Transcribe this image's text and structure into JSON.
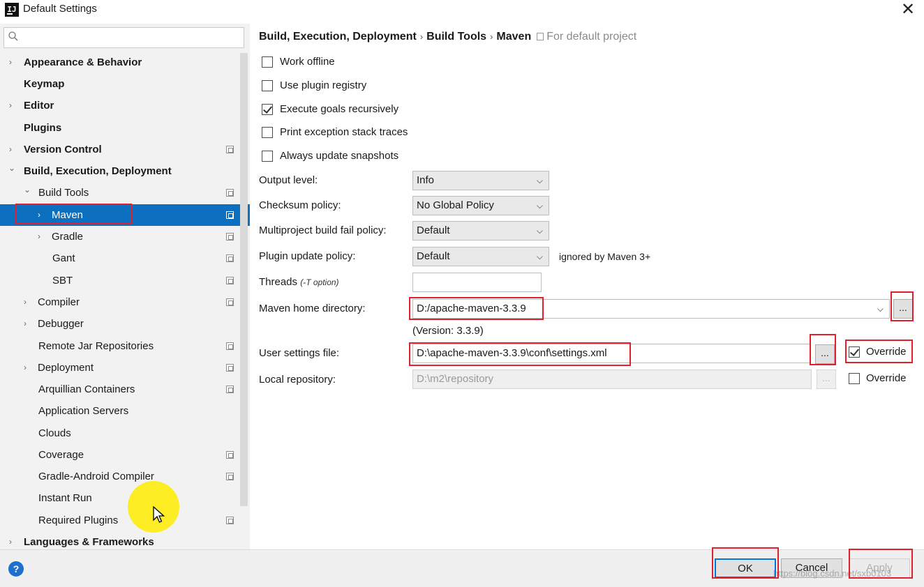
{
  "window": {
    "title": "Default Settings",
    "icon_text": "IJ",
    "close_glyph": "✕"
  },
  "search": {
    "placeholder": "",
    "value": ""
  },
  "sidebar": {
    "items": [
      {
        "label": "Appearance & Behavior",
        "expanded": false
      },
      {
        "label": "Keymap"
      },
      {
        "label": "Editor",
        "expanded": false
      },
      {
        "label": "Plugins"
      },
      {
        "label": "Version Control",
        "expanded": false
      },
      {
        "label": "Build, Execution, Deployment",
        "expanded": true
      },
      {
        "label": "Build Tools",
        "expanded": true
      },
      {
        "label": "Maven",
        "selected": true
      },
      {
        "label": "Gradle"
      },
      {
        "label": "Gant"
      },
      {
        "label": "SBT"
      },
      {
        "label": "Compiler"
      },
      {
        "label": "Debugger"
      },
      {
        "label": "Remote Jar Repositories"
      },
      {
        "label": "Deployment"
      },
      {
        "label": "Arquillian Containers"
      },
      {
        "label": "Application Servers"
      },
      {
        "label": "Clouds"
      },
      {
        "label": "Coverage"
      },
      {
        "label": "Gradle-Android Compiler"
      },
      {
        "label": "Instant Run"
      },
      {
        "label": "Required Plugins"
      },
      {
        "label": "Languages & Frameworks",
        "expanded": false
      }
    ],
    "arrow_collapsed": "›",
    "arrow_expanded": "⌄"
  },
  "breadcrumb": {
    "parts": [
      "Build, Execution, Deployment",
      "Build Tools",
      "Maven"
    ],
    "separator": "›",
    "scope_hint": "For default project"
  },
  "checkboxes": {
    "work_offline": {
      "label": "Work offline",
      "checked": false
    },
    "use_plugin_registry": {
      "label": "Use plugin registry",
      "checked": false
    },
    "execute_goals_recursively": {
      "label": "Execute goals recursively",
      "checked": true
    },
    "print_exception_stack_traces": {
      "label": "Print exception stack traces",
      "checked": false
    },
    "always_update_snapshots": {
      "label": "Always update snapshots",
      "checked": false
    }
  },
  "form": {
    "output_level": {
      "label": "Output level:",
      "value": "Info"
    },
    "checksum_policy": {
      "label": "Checksum policy:",
      "value": "No Global Policy"
    },
    "multiproject_fail_policy": {
      "label": "Multiproject build fail policy:",
      "value": "Default"
    },
    "plugin_update_policy": {
      "label": "Plugin update policy:",
      "value": "Default",
      "note": "ignored by Maven 3+"
    },
    "threads": {
      "label": "Threads",
      "hint": "(-T option)",
      "value": ""
    },
    "maven_home": {
      "label": "Maven home directory:",
      "value": "D:/apache-maven-3.3.9",
      "version": "(Version: 3.3.9)",
      "browse_label": "..."
    },
    "user_settings": {
      "label": "User settings file:",
      "value": "D:\\apache-maven-3.3.9\\conf\\settings.xml",
      "browse_label": "...",
      "override_label": "Override",
      "override_checked": true
    },
    "local_repo": {
      "label": "Local repository:",
      "value": "D:\\m2\\repository",
      "browse_label": "...",
      "override_label": "Override",
      "override_checked": false
    }
  },
  "buttons": {
    "ok": "OK",
    "cancel": "Cancel",
    "apply": "Apply",
    "help": "?"
  },
  "watermark": "https://blog.csdn.net/sxb0103",
  "colors": {
    "selection": "#0c6fc0",
    "highlight_box": "#e0202a",
    "primary_border": "#0078d7",
    "cursor_highlight": "#ffec00"
  }
}
